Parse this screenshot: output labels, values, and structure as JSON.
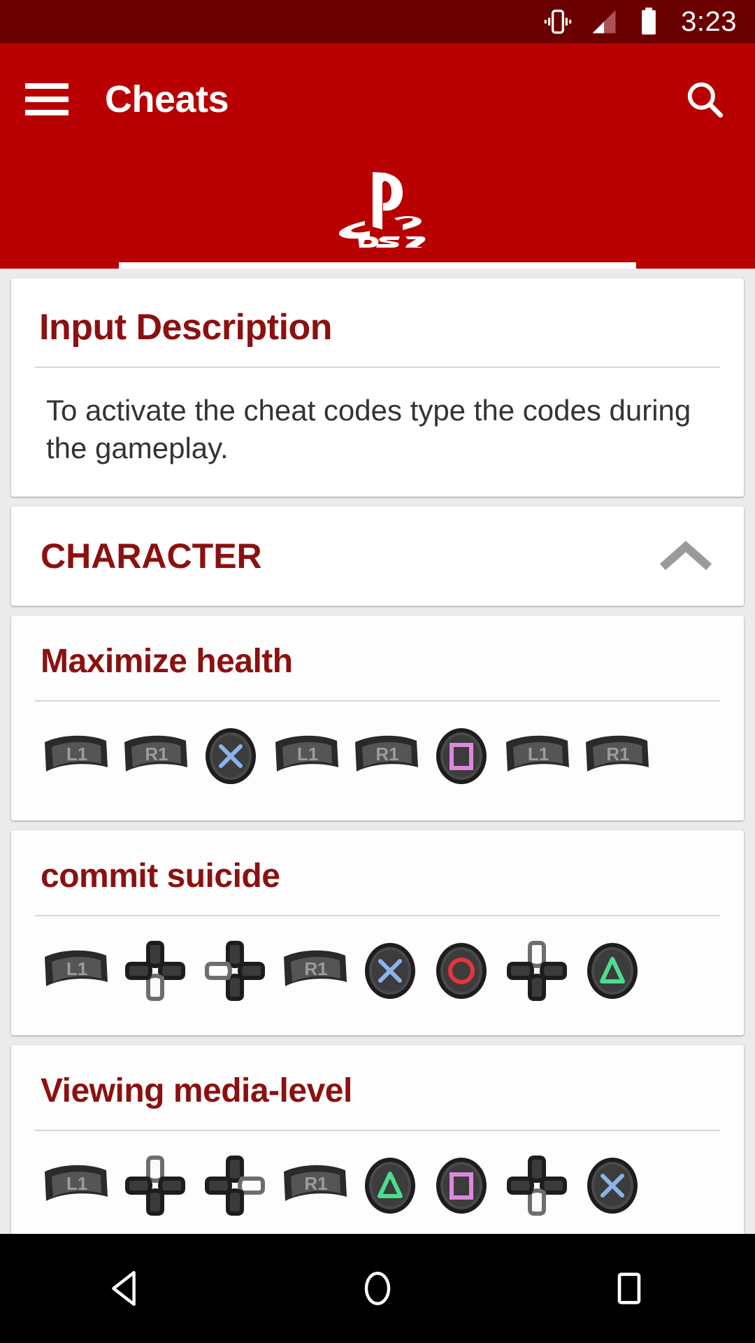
{
  "status_bar": {
    "time": "3:23",
    "icons": [
      "vibrate-icon",
      "signal-icon",
      "battery-icon"
    ]
  },
  "toolbar": {
    "menu_icon": "hamburger-menu-icon",
    "title": "Cheats",
    "search_icon": "search-icon",
    "accent_color": "#b80000",
    "status_color": "#6b0000"
  },
  "tab": {
    "logo_label": "PS2",
    "logo_icon": "playstation-2-logo",
    "selected": true
  },
  "description_card": {
    "title": "Input Description",
    "body": "To activate the cheat codes type the codes during the gameplay."
  },
  "section": {
    "title": "CHARACTER",
    "expanded": true,
    "chevron_icon": "chevron-up-icon"
  },
  "cheats": [
    {
      "title": "Maximize health",
      "codes": [
        {
          "type": "shoulder",
          "label": "L1"
        },
        {
          "type": "shoulder",
          "label": "R1"
        },
        {
          "type": "face",
          "shape": "cross",
          "color": "#8ab4e8"
        },
        {
          "type": "shoulder",
          "label": "L1"
        },
        {
          "type": "shoulder",
          "label": "R1"
        },
        {
          "type": "face",
          "shape": "square",
          "color": "#dd88dd"
        },
        {
          "type": "shoulder",
          "label": "L1"
        },
        {
          "type": "shoulder",
          "label": "R1"
        }
      ]
    },
    {
      "title": "commit suicide",
      "codes": [
        {
          "type": "shoulder",
          "label": "L1"
        },
        {
          "type": "dpad",
          "direction": "down"
        },
        {
          "type": "dpad",
          "direction": "left"
        },
        {
          "type": "shoulder",
          "label": "R1"
        },
        {
          "type": "face",
          "shape": "cross",
          "color": "#8ab4e8"
        },
        {
          "type": "face",
          "shape": "circle",
          "color": "#e8333a"
        },
        {
          "type": "dpad",
          "direction": "up"
        },
        {
          "type": "face",
          "shape": "triangle",
          "color": "#4ddd8f"
        }
      ]
    },
    {
      "title": "Viewing media-level",
      "codes": [
        {
          "type": "shoulder",
          "label": "L1"
        },
        {
          "type": "dpad",
          "direction": "up"
        },
        {
          "type": "dpad",
          "direction": "right"
        },
        {
          "type": "shoulder",
          "label": "R1"
        },
        {
          "type": "face",
          "shape": "triangle",
          "color": "#4ddd8f"
        },
        {
          "type": "face",
          "shape": "square",
          "color": "#dd88dd"
        },
        {
          "type": "dpad",
          "direction": "down"
        },
        {
          "type": "face",
          "shape": "cross",
          "color": "#8ab4e8"
        }
      ]
    }
  ],
  "navbar": {
    "back_icon": "back-triangle-icon",
    "home_icon": "home-circle-icon",
    "recents_icon": "recents-square-icon"
  }
}
